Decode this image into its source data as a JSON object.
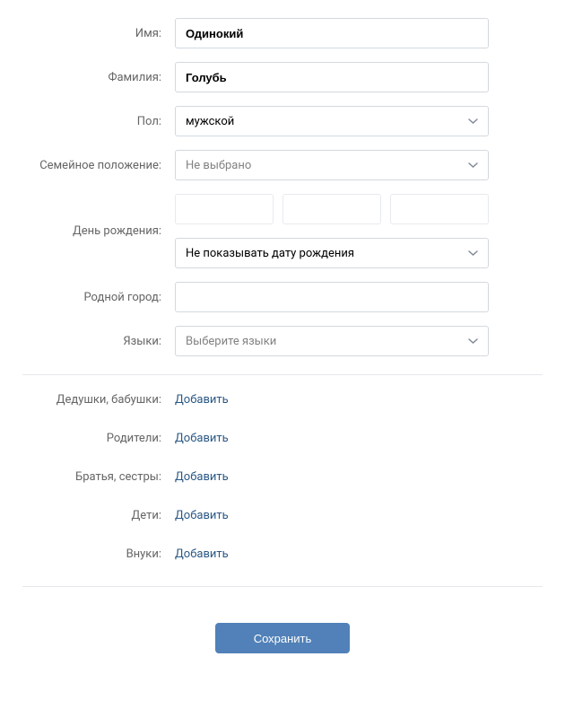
{
  "fields": {
    "firstName": {
      "label": "Имя:",
      "value": "Одинокий"
    },
    "lastName": {
      "label": "Фамилия:",
      "value": "Голубь"
    },
    "gender": {
      "label": "Пол:",
      "value": "мужской"
    },
    "maritalStatus": {
      "label": "Семейное положение:",
      "value": "Не выбрано"
    },
    "birthday": {
      "label": "День рождения:",
      "visibility": "Не показывать дату рождения"
    },
    "hometown": {
      "label": "Родной город:",
      "value": ""
    },
    "languages": {
      "label": "Языки:",
      "placeholder": "Выберите языки"
    }
  },
  "family": {
    "grandparents": {
      "label": "Дедушки, бабушки:",
      "action": "Добавить"
    },
    "parents": {
      "label": "Родители:",
      "action": "Добавить"
    },
    "siblings": {
      "label": "Братья, сестры:",
      "action": "Добавить"
    },
    "children": {
      "label": "Дети:",
      "action": "Добавить"
    },
    "grandchildren": {
      "label": "Внуки:",
      "action": "Добавить"
    }
  },
  "buttons": {
    "save": "Сохранить"
  }
}
